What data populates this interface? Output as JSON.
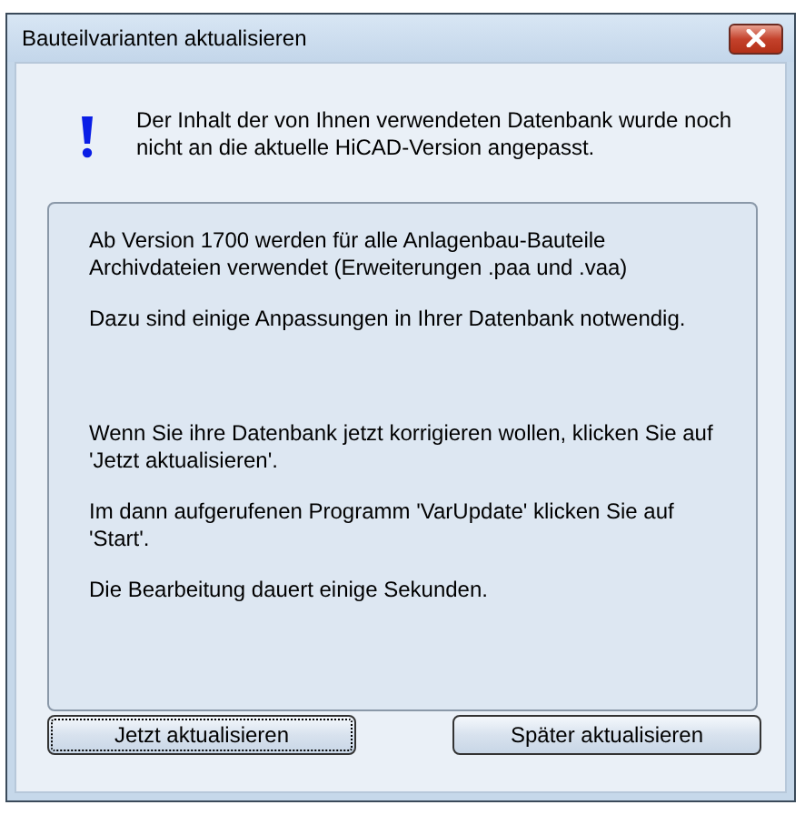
{
  "window": {
    "title": "Bauteilvarianten aktualisieren"
  },
  "message": "Der Inhalt der von Ihnen verwendeten Datenbank wurde noch nicht an die aktuelle HiCAD-Version angepasst.",
  "details": [
    "Ab Version 1700 werden für alle Anlagenbau-Bauteile Archivdateien verwendet (Erweiterungen .paa und .vaa)",
    "Dazu sind einige Anpassungen in Ihrer Datenbank notwendig.",
    "Wenn Sie ihre Datenbank jetzt korrigieren wollen, klicken Sie auf 'Jetzt aktualisieren'.",
    "Im dann aufgerufenen Programm 'VarUpdate' klicken Sie auf 'Start'.",
    "Die Bearbeitung dauert einige Sekunden."
  ],
  "buttons": [
    {
      "label": "Jetzt aktualisieren",
      "focused": true
    },
    {
      "label": "Später aktualisieren",
      "focused": false
    }
  ]
}
